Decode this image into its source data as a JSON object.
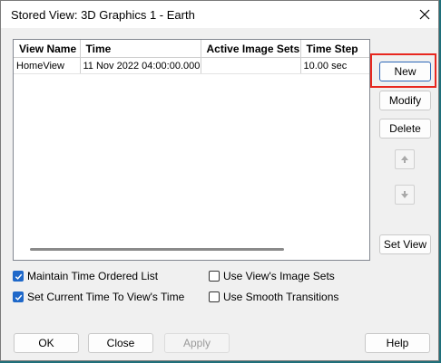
{
  "window": {
    "title": "Stored View: 3D Graphics 1 - Earth"
  },
  "table": {
    "columns": [
      "View Name",
      "Time",
      "Active Image Sets",
      "Time Step"
    ],
    "rows": [
      {
        "view_name": "HomeView",
        "time": "11 Nov 2022 04:00:00.000",
        "active_image_sets": "",
        "time_step": "10.00 sec"
      }
    ]
  },
  "side_buttons": {
    "new": "New",
    "modify": "Modify",
    "delete": "Delete",
    "set_view": "Set View"
  },
  "options": {
    "maintain_time_ordered": {
      "label": "Maintain Time Ordered List",
      "checked": true
    },
    "set_current_time": {
      "label": "Set Current Time To View's Time",
      "checked": true
    },
    "use_view_image_sets": {
      "label": "Use View's Image Sets",
      "checked": false
    },
    "use_smooth_transitions": {
      "label": "Use Smooth Transitions",
      "checked": false
    }
  },
  "footer": {
    "ok": "OK",
    "close": "Close",
    "apply": "Apply",
    "help": "Help"
  },
  "colors": {
    "highlight": "#e8271f",
    "checkbox_on": "#1f68c9"
  }
}
